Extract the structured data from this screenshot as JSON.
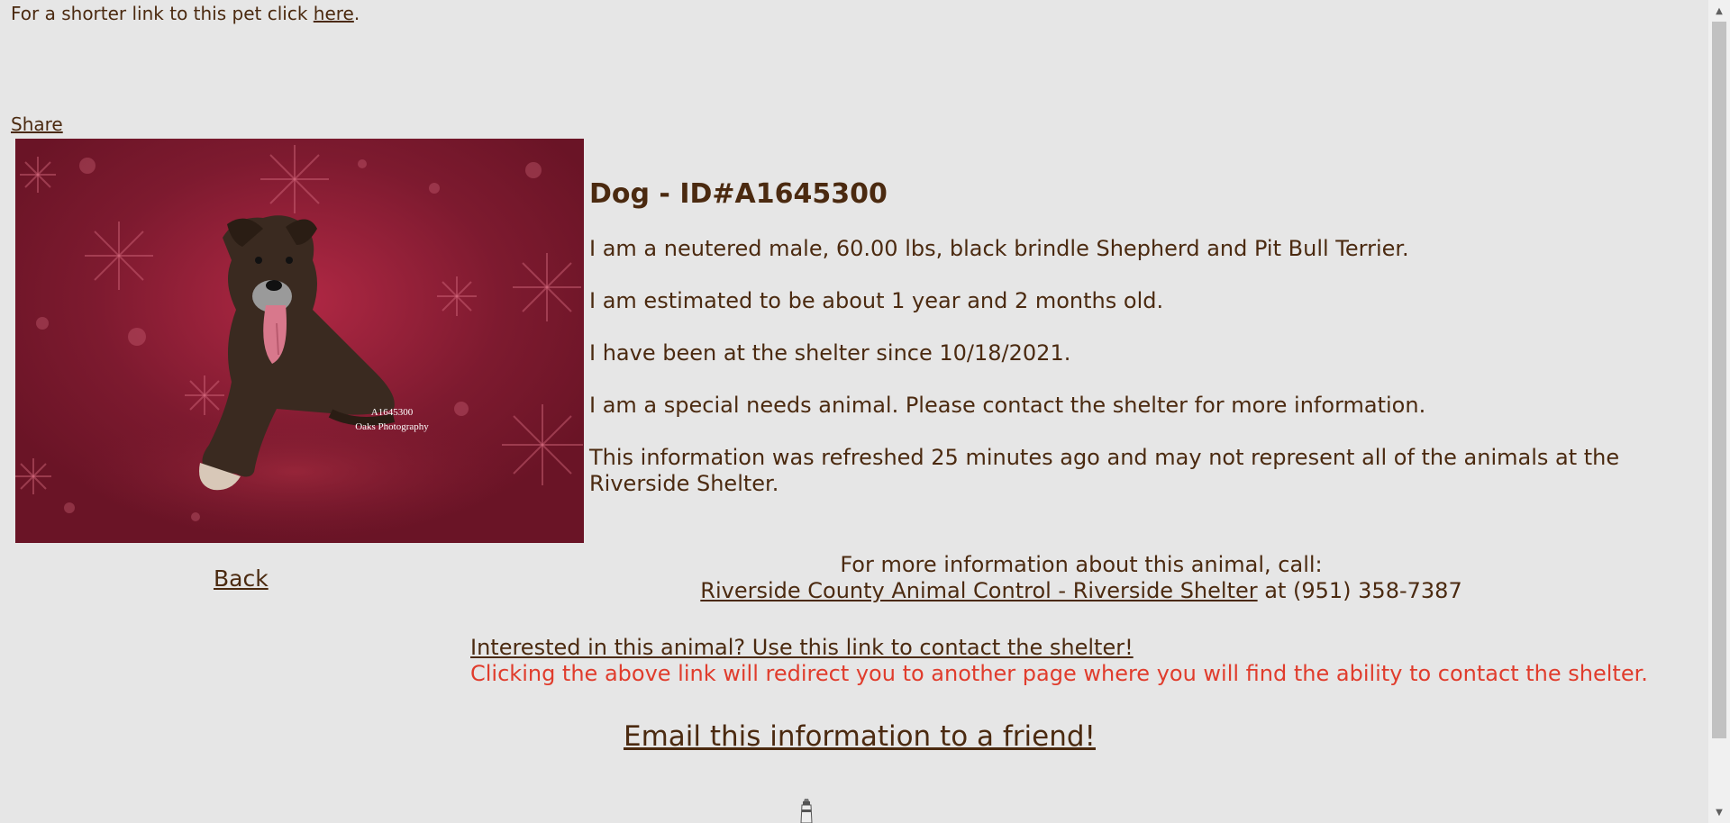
{
  "header": {
    "short_link_prefix": "For a shorter link to this pet click ",
    "short_link_label": "here",
    "short_link_suffix": ".",
    "share_label": "Share"
  },
  "photo": {
    "caption_id": "A1645300",
    "caption_credit": "Oaks Photography",
    "background_color": "#7a1a2e"
  },
  "nav": {
    "back_label": "Back"
  },
  "animal": {
    "title": "Dog - ID#A1645300",
    "description": "I am a neutered male, 60.00 lbs, black brindle Shepherd and Pit Bull Terrier.",
    "age": "I am estimated to be about 1 year and 2 months old.",
    "intake": "I have been at the shelter since 10/18/2021.",
    "special_needs": "I am a special needs animal. Please contact the shelter for more information.",
    "refresh_note": "This information was refreshed 25 minutes ago and may not represent all of the animals at the Riverside Shelter."
  },
  "contact": {
    "call_prompt": "For more information about this animal, call:",
    "shelter_link": "Riverside County Animal Control - Riverside Shelter",
    "phone_text": " at (951) 358-7387",
    "interested_link": "Interested in this animal? Use this link to contact the shelter!",
    "redirect_note": "Clicking the above link will redirect you to another page where you will find the ability to contact the shelter.",
    "email_link": "Email this information to a friend!"
  },
  "colors": {
    "text": "#4b2a10",
    "warning": "#e03c2c",
    "background": "#e6e6e6"
  }
}
